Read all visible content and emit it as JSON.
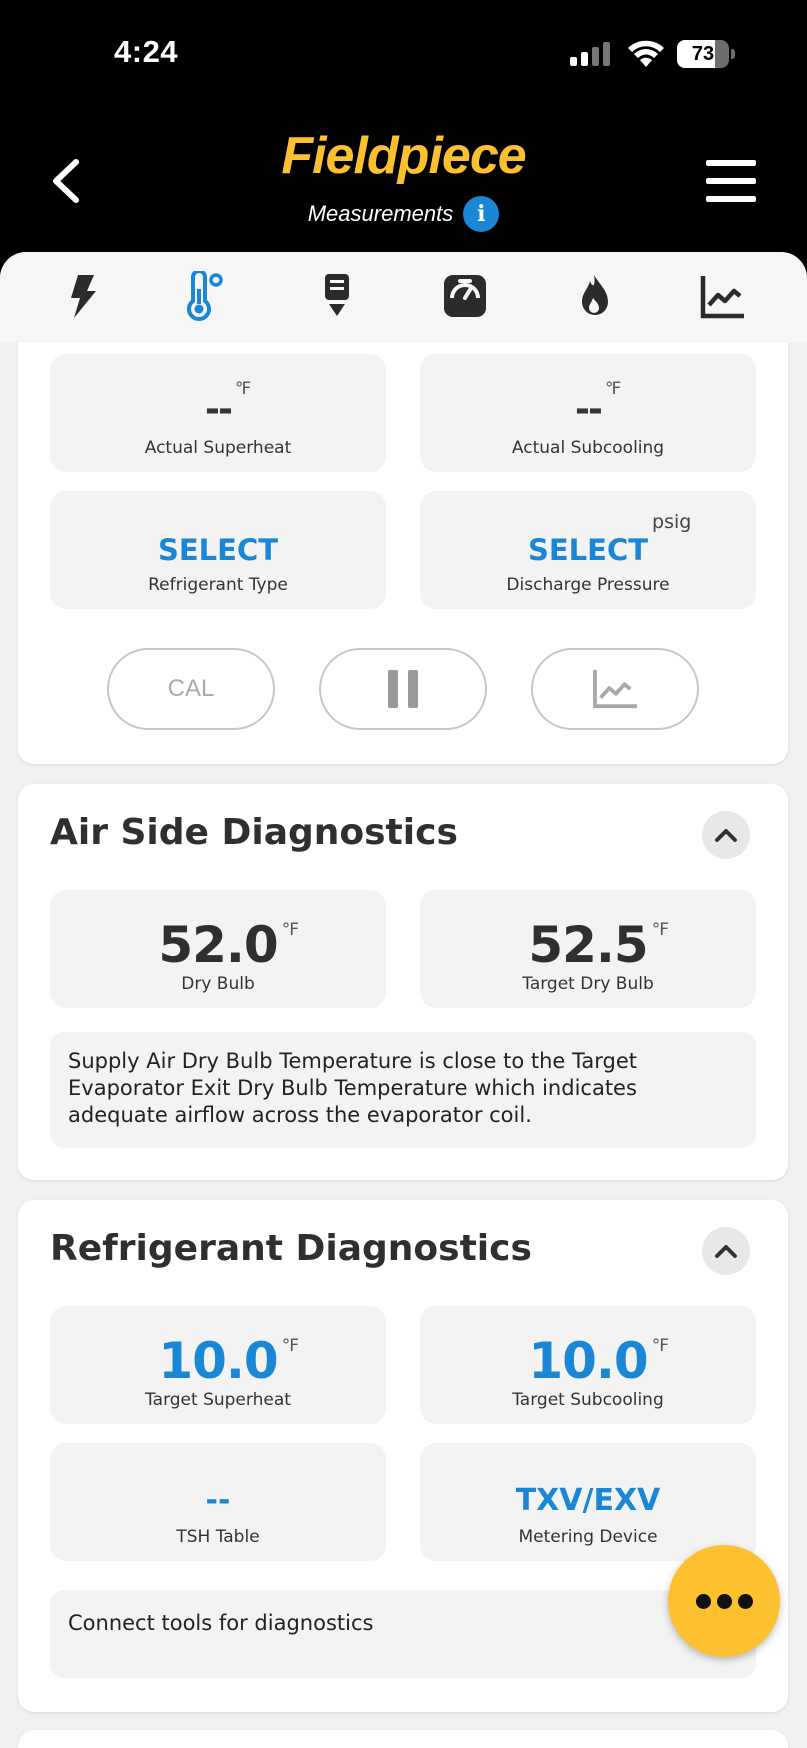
{
  "status_bar": {
    "time": "4:24",
    "battery": "73",
    "battery_level": 0.73
  },
  "header": {
    "brand": "Fieldpiece",
    "subtitle": "Measurements"
  },
  "colors": {
    "accent_blue": "#1a86d6",
    "brand_yellow": "#fdc12f",
    "header_bg": "#000000"
  },
  "tabs": [
    {
      "icon": "lightning-icon"
    },
    {
      "icon": "thermometer-icon",
      "active": true
    },
    {
      "icon": "probe-icon"
    },
    {
      "icon": "gauge-icon"
    },
    {
      "icon": "flame-icon"
    },
    {
      "icon": "chart-icon"
    }
  ],
  "system_card": {
    "actual_superheat": {
      "value": "--",
      "unit": "°F",
      "label": "Actual Superheat"
    },
    "actual_subcooling": {
      "value": "--",
      "unit": "°F",
      "label": "Actual Subcooling"
    },
    "refrigerant_type": {
      "value": "SELECT",
      "label": "Refrigerant Type"
    },
    "discharge_pressure": {
      "value": "SELECT",
      "unit": "psig",
      "label": "Discharge Pressure"
    },
    "cal_label": "CAL"
  },
  "air_side": {
    "title": "Air Side Diagnostics",
    "dry_bulb": {
      "value": "52.0",
      "unit": "°F",
      "label": "Dry Bulb"
    },
    "target_dry_bulb": {
      "value": "52.5",
      "unit": "°F",
      "label": "Target Dry Bulb"
    },
    "message": "Supply Air Dry Bulb Temperature is close to the Target Evaporator Exit Dry Bulb Temperature which indicates adequate airflow across the evaporator coil."
  },
  "refrigerant": {
    "title": "Refrigerant Diagnostics",
    "target_superheat": {
      "value": "10.0",
      "unit": "°F",
      "label": "Target Superheat"
    },
    "target_subcooling": {
      "value": "10.0",
      "unit": "°F",
      "label": "Target Subcooling"
    },
    "tsh_table": {
      "value": "--",
      "label": "TSH Table"
    },
    "metering_device": {
      "value": "TXV/EXV",
      "label": "Metering Device"
    },
    "message": "Connect tools for diagnostics"
  }
}
